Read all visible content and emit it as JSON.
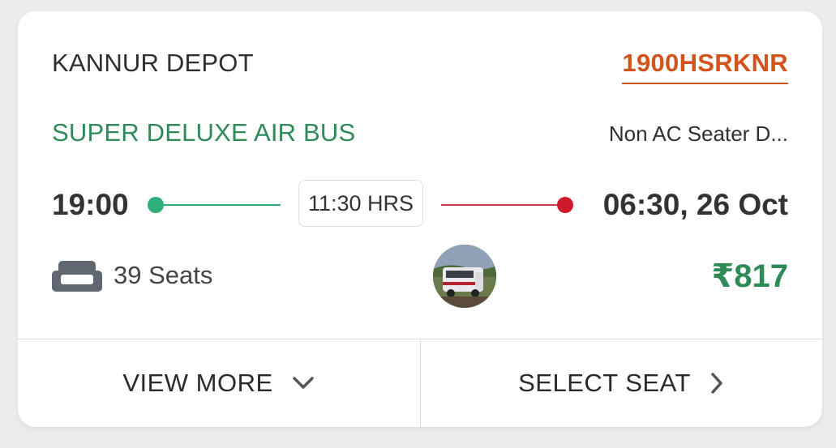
{
  "header": {
    "depot": "KANNUR DEPOT",
    "service_code": "1900HSRKNR"
  },
  "bus": {
    "type": "SUPER DELUXE AIR BUS",
    "class": "Non AC Seater D..."
  },
  "schedule": {
    "departure": "19:00",
    "duration": "11:30 HRS",
    "arrival": "06:30, 26 Oct"
  },
  "info": {
    "seats": "39 Seats",
    "price": "₹817",
    "seat_icon": "sofa-icon",
    "bus_image": "bus-photo-avatar"
  },
  "actions": {
    "view_more": "VIEW MORE",
    "view_more_icon": "chevron-down-icon",
    "select_seat": "SELECT SEAT",
    "select_seat_icon": "chevron-right-icon"
  },
  "colors": {
    "service_code": "#d2541c",
    "bus_type": "#2e8b57",
    "price": "#2e8b57",
    "departure_dot": "#2eb07a",
    "arrival_dot": "#d0182b"
  }
}
